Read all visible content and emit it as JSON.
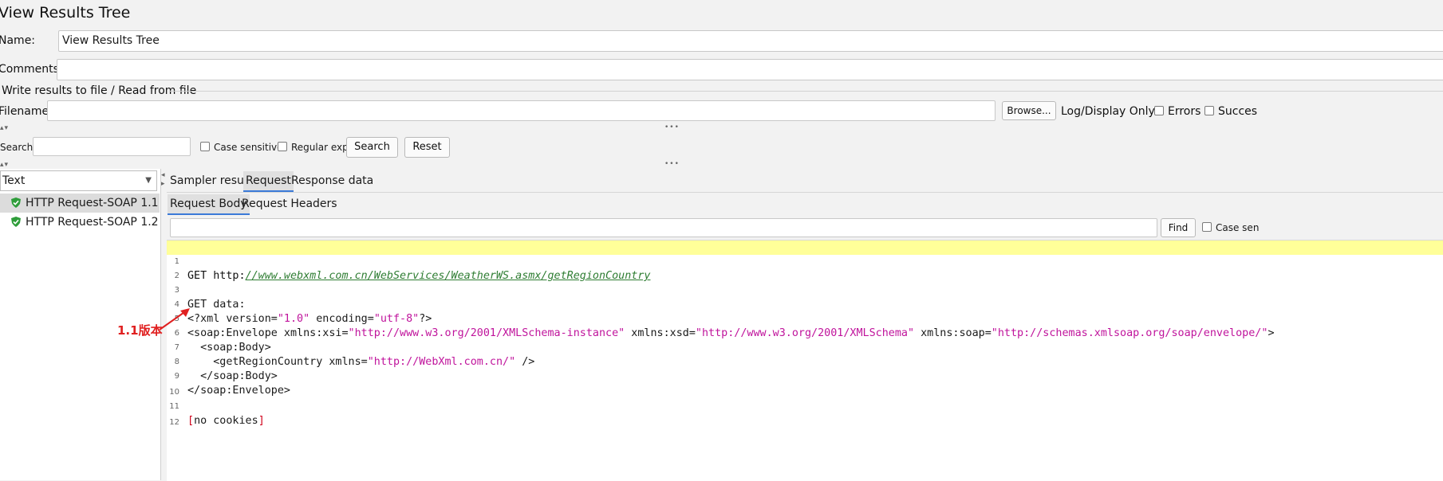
{
  "window": {
    "title": "View Results Tree"
  },
  "form": {
    "name_label": "Name:",
    "name_value": "View Results Tree",
    "comments_label": "Comments:",
    "comments_value": "",
    "file_section_title": "Write results to file / Read from file",
    "filename_label": "Filename",
    "filename_value": "",
    "browse_label": "Browse...",
    "log_display_label": "Log/Display Only:",
    "errors_label": "Errors",
    "successes_label": "Succes"
  },
  "search": {
    "label": "Search:",
    "value": "",
    "case_sensitive_label": "Case sensitive",
    "regex_label": "Regular exp.",
    "search_button": "Search",
    "reset_button": "Reset"
  },
  "left": {
    "renderer": "Text",
    "items": [
      {
        "label": "HTTP Request-SOAP 1.1",
        "selected": true
      },
      {
        "label": "HTTP Request-SOAP 1.2",
        "selected": false
      }
    ]
  },
  "tabs": {
    "main": [
      "Sampler result",
      "Request",
      "Response data"
    ],
    "main_active": "Request",
    "sub": [
      "Request Body",
      "Request Headers"
    ],
    "sub_active": "Request Body"
  },
  "find": {
    "value": "",
    "button": "Find",
    "case_label": "Case sen"
  },
  "code": {
    "line_numbers": [
      "1",
      "2",
      "3",
      "4",
      "5",
      "6",
      "7",
      "8",
      "9",
      "10",
      "11",
      "12"
    ],
    "l1_method": "GET ",
    "l1_scheme": "http:",
    "l1_url": "//www.webxml.com.cn/WebServices/WeatherWS.asmx/getRegionCountry",
    "l3": "GET data:",
    "l4_a": "<?xml version=",
    "l4_b": "\"1.0\"",
    "l4_c": " encoding=",
    "l4_d": "\"utf-8\"",
    "l4_e": "?>",
    "l5_a": "<soap:Envelope xmlns:xsi=",
    "l5_b": "\"http://www.w3.org/2001/XMLSchema-instance\"",
    "l5_c": " xmlns:xsd=",
    "l5_d": "\"http://www.w3.org/2001/XMLSchema\"",
    "l5_e": " xmlns:soap=",
    "l5_f": "\"http://schemas.xmlsoap.org/soap/envelope/\"",
    "l5_g": ">",
    "l6": "  <soap:Body>",
    "l7_a": "    <getRegionCountry xmlns=",
    "l7_b": "\"http://WebXml.com.cn/\"",
    "l7_c": " />",
    "l8": "  </soap:Body>",
    "l9": "</soap:Envelope>",
    "l11_a": "[",
    "l11_b": "no cookies",
    "l11_c": "]"
  },
  "annotation": {
    "text": "1.1版本",
    "color": "#e02020"
  },
  "colors": {
    "accent": "#3b7ad8",
    "highlight_line": "#ffff99",
    "string": "#c0149c",
    "url": "#2e7d32",
    "success_shield": "#2e9d3a"
  }
}
